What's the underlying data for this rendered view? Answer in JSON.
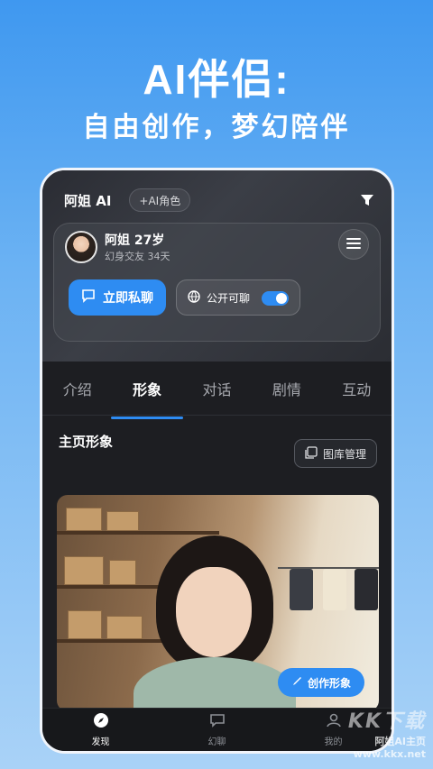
{
  "promo": {
    "title": "AI伴侣:",
    "subtitle": "自由创作，梦幻陪伴"
  },
  "header": {
    "app_title": "阿姐 AI",
    "add_role_label": "+AI角色",
    "filter_icon": "filter-icon"
  },
  "character": {
    "name": "阿姐  27岁",
    "meta": "幻身交友 34天"
  },
  "actions": {
    "chat_label": "立即私聊",
    "public_label": "公开可聊",
    "public_enabled": true
  },
  "tabs": [
    "介绍",
    "形象",
    "对话",
    "剧情",
    "互动"
  ],
  "active_tab": "形象",
  "section": {
    "title": "主页形象",
    "gallery_label": "图库管理",
    "create_label": "创作形象"
  },
  "bottom_nav": [
    {
      "label": "发现",
      "icon": "compass-icon",
      "active": true
    },
    {
      "label": "幻聊",
      "icon": "chat-icon",
      "active": false
    },
    {
      "label": "我的",
      "icon": "person-icon",
      "active": false
    }
  ],
  "watermark": {
    "brand": "KK下载",
    "caption": "阿姐AI主页",
    "url": "www.kkx.net"
  },
  "colors": {
    "accent": "#2e8cf2",
    "background_top": "#3f98f0",
    "card_dark": "#1d1e22"
  }
}
